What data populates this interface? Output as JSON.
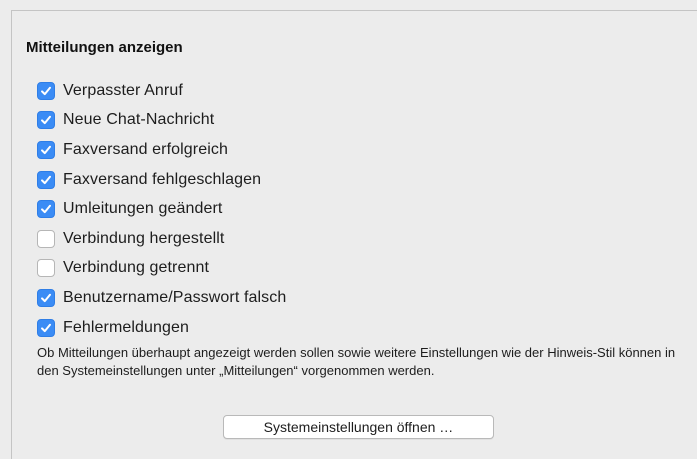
{
  "section": {
    "title": "Mitteilungen anzeigen"
  },
  "options": [
    {
      "label": "Verpasster Anruf",
      "checked": true
    },
    {
      "label": "Neue Chat-Nachricht",
      "checked": true
    },
    {
      "label": "Faxversand erfolgreich",
      "checked": true
    },
    {
      "label": "Faxversand fehlgeschlagen",
      "checked": true
    },
    {
      "label": "Umleitungen geändert",
      "checked": true
    },
    {
      "label": "Verbindung hergestellt",
      "checked": false
    },
    {
      "label": "Verbindung getrennt",
      "checked": false
    },
    {
      "label": "Benutzername/Passwort falsch",
      "checked": true
    },
    {
      "label": "Fehlermeldungen",
      "checked": true
    }
  ],
  "info": {
    "text": "Ob Mitteilungen überhaupt angezeigt werden sollen sowie weitere Einstellungen wie der Hinweis-Stil können in den Systemeinstellungen unter „Mitteilungen“ vorgenommen werden."
  },
  "button": {
    "label": "Systemeinstellungen öffnen …"
  },
  "colors": {
    "accent": "#3b8cf5",
    "background": "#ececec"
  },
  "icons": {
    "checked": "checkmark-icon"
  }
}
